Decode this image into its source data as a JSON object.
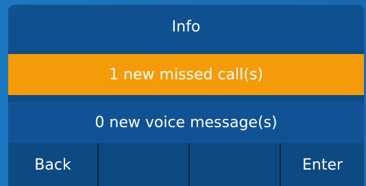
{
  "screen": {
    "title": "Info"
  },
  "list": {
    "items": [
      {
        "label": "1 new missed call(s)",
        "selected": true
      },
      {
        "label": "0 new voice message(s)",
        "selected": false
      }
    ]
  },
  "softkeys": {
    "back_label": "Back",
    "key2_label": "",
    "key3_label": "",
    "enter_label": "Enter"
  },
  "colors": {
    "accent_selected": "#f59b0a",
    "panel": "#0f5190",
    "background": "#1a6db0"
  }
}
